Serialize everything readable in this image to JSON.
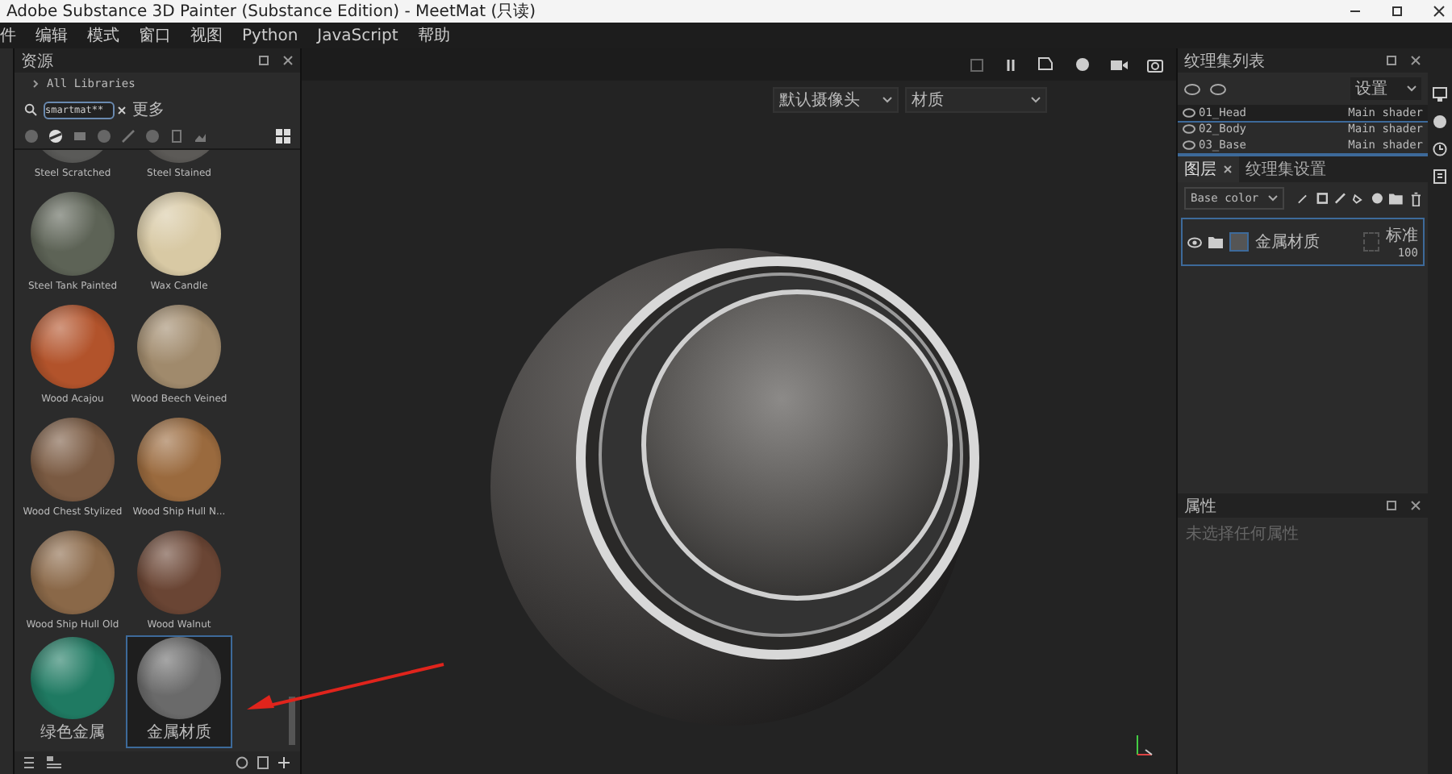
{
  "window": {
    "title": "Adobe Substance 3D Painter (Substance Edition) - MeetMat (只读)"
  },
  "menu": [
    "件",
    "编辑",
    "模式",
    "窗口",
    "视图",
    "Python",
    "JavaScript",
    "帮助"
  ],
  "assets": {
    "title": "资源",
    "library": "All Libraries",
    "search": "smartmat**",
    "search_label": "更多",
    "materials": [
      {
        "name": "Steel Scratched",
        "color": "#5a5a58",
        "selected": false
      },
      {
        "name": "Steel Stained",
        "color": "#5c5a57",
        "selected": false
      },
      {
        "name": "Steel Tank Painted",
        "color": "#5d6356",
        "selected": false
      },
      {
        "name": "Wax Candle",
        "color": "#d8c9a4",
        "selected": false
      },
      {
        "name": "Wood Acajou",
        "color": "#b2532b",
        "selected": false
      },
      {
        "name": "Wood Beech Veined",
        "color": "#a08a6c",
        "selected": false
      },
      {
        "name": "Wood Chest Stylized",
        "color": "#7a5a42",
        "selected": false
      },
      {
        "name": "Wood Ship Hull N...",
        "color": "#9a6a3e",
        "selected": false
      },
      {
        "name": "Wood Ship Hull Old",
        "color": "#8a6848",
        "selected": false
      },
      {
        "name": "Wood Walnut",
        "color": "#6a4534",
        "selected": false
      },
      {
        "name": "绿色金属",
        "color": "#1f7a62",
        "selected": false
      },
      {
        "name": "金属材质",
        "color": "#6a6a6a",
        "selected": true
      }
    ]
  },
  "viewport": {
    "dropdowns": [
      "默认摄像头",
      "材质"
    ]
  },
  "texture_set_list": {
    "title": "纹理集列表",
    "settings": "设置",
    "rows": [
      {
        "name": "01_Head",
        "shader": "Main shader",
        "selected": true
      },
      {
        "name": "02_Body",
        "shader": "Main shader",
        "selected": false
      },
      {
        "name": "03_Base",
        "shader": "Main shader",
        "selected": false
      }
    ]
  },
  "tabs": [
    {
      "label": "图层",
      "selected": true
    },
    {
      "label": "纹理集设置",
      "selected": false
    }
  ],
  "channel": "Base color",
  "layers": [
    {
      "name": "金属材质",
      "blend": "标准",
      "opacity": "100",
      "visible": true
    }
  ],
  "properties": {
    "title": "属性",
    "hint": "未选择任何属性"
  }
}
